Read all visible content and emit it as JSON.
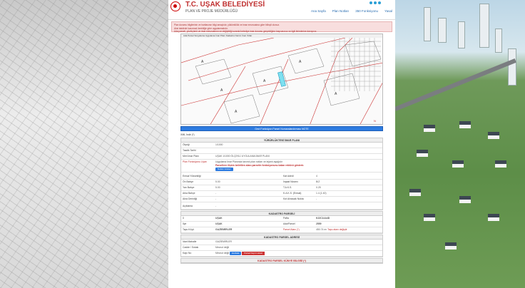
{
  "header": {
    "title": "T.C. UŞAK BELEDİYESİ",
    "subtitle": "PLAN VE PROJE MÜDÜRLÜĞÜ",
    "nav": [
      "Ana Sayfa",
      "Plan Notları",
      "350 Fonksiyonu",
      "Yasal"
    ]
  },
  "alerts": [
    "Plan durumu bilgilerinin ve haritasının bilgi amaçlıdır, yükümlülük ve imar mevzuatına göre bilinçli olunuz.",
    "Aksi takdirde kurumsal özerkliğe göre uygulanmalıdır.",
    "Ada parseli, yüzölçümü ve imar mevzuatının ve değişikliği sonraki belediye imar durumu gerçekliğine başvurunuz ve ilgili birimlerine danışınız."
  ],
  "map": {
    "toolbar": "Ada Parsel Sorgulama   Uygulama İmar Planı   Kadastro   Nazım İmar   Yollar"
  },
  "tool_button": "Gezi Fonksiyon Parsel Numaralandırması NOTE",
  "xml_label": "XML İndir (*)",
  "plan_section": {
    "title": "YÜRÜRLÜKTEKİ İMAR PLANI",
    "rows": [
      {
        "label": "Ölçeği",
        "value": "1/1000"
      },
      {
        "label": "Tasdik Tarihi",
        "value": ""
      },
      {
        "label": "Meri İmar Planı",
        "value": "UŞAK 1/1000 ÖLÇEKLİ UYGULAMA İMAR PLANI"
      }
    ]
  },
  "fonksiyon": {
    "label": "Plan Fonksiyonu Uyarı",
    "text1": "Uygulama İmar Planında tanımlı plan notları ve lejantı aşağıdır",
    "text2": "Parsellere ilişkin belirtilen alanı parselin fonksiyonunu kalan rektörü gösterir.",
    "button": "Notları Göster"
  },
  "yapi": {
    "left": [
      {
        "label": "Emsal Yüksekliği",
        "value": ""
      },
      {
        "label": "Ön Bahçe",
        "value": "5.00"
      },
      {
        "label": "Yan Bahçe",
        "value": "5.00"
      },
      {
        "label": "Arka Bahçe",
        "value": "-"
      },
      {
        "label": "Akra Derinliği",
        "value": "-"
      }
    ],
    "right": [
      {
        "label": "Kat Adedi",
        "value": "4"
      },
      {
        "label": "İnşaat Nizamı",
        "value": "B/Z"
      },
      {
        "label": "T.A.K.S.",
        "value": "0.25"
      },
      {
        "label": "K.A.K.S. (Emsal)",
        "value": "1.4 (1.40)"
      },
      {
        "label": "Kot Alınacak Nokta",
        "value": "-"
      }
    ],
    "aciklama": {
      "label": "Açıklama",
      "value": "-"
    }
  },
  "kadastro": {
    "title": "KADASTRO PARSELİ",
    "left": [
      {
        "label": "İl",
        "value": "UŞAK"
      },
      {
        "label": "İlçe",
        "value": "UŞAK"
      },
      {
        "label": "Tapu Köyü",
        "value": "GAZİEMİRLER"
      }
    ],
    "right": [
      {
        "label": "Pafta",
        "value": "K22C14A4D"
      },
      {
        "label": "Ada/Parsel",
        "value": "2559"
      },
      {
        "label": "Parsel Alanı (*)",
        "value": "450.74 m²"
      }
    ],
    "note": "Tapu alanı değiştir"
  },
  "kadastro_adres": {
    "title": "KADASTRO PARSEL ADRESİ",
    "rows": [
      {
        "label": "İdari Mahalle",
        "value": "GAZİEMİRLER"
      },
      {
        "label": "Cadde / Sokak",
        "value": "Mevcut değil"
      },
      {
        "label": "Kapı No",
        "value": "Mevcut değil"
      }
    ],
    "btn1": "Haritala",
    "btn2": "Parsel Kayıt Listesi"
  },
  "kadastro_kunye": {
    "title": "KADASTRO PARSEL KÜNYE BİLGİSİ (*)"
  },
  "colors": {
    "brand": "#c03030",
    "link": "#2a6db0",
    "button": "#2d7be0"
  }
}
